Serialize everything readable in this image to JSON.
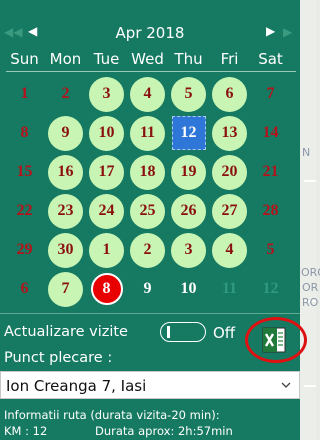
{
  "calendar": {
    "month_title": "Apr 2018",
    "prev_label": "◀",
    "next_label": "▶",
    "weekdays": [
      "Sun",
      "Mon",
      "Tue",
      "Wed",
      "Thu",
      "Fri",
      "Sat"
    ],
    "weeks": [
      [
        {
          "d": "1",
          "s": "plain-red"
        },
        {
          "d": "2",
          "s": "plain-red"
        },
        {
          "d": "3",
          "s": "avail"
        },
        {
          "d": "4",
          "s": "avail"
        },
        {
          "d": "5",
          "s": "avail"
        },
        {
          "d": "6",
          "s": "avail"
        },
        {
          "d": "7",
          "s": "plain-red"
        }
      ],
      [
        {
          "d": "8",
          "s": "plain-red"
        },
        {
          "d": "9",
          "s": "avail"
        },
        {
          "d": "10",
          "s": "avail"
        },
        {
          "d": "11",
          "s": "avail"
        },
        {
          "d": "12",
          "s": "selected"
        },
        {
          "d": "13",
          "s": "avail"
        },
        {
          "d": "14",
          "s": "plain-red"
        }
      ],
      [
        {
          "d": "15",
          "s": "plain-red"
        },
        {
          "d": "16",
          "s": "avail"
        },
        {
          "d": "17",
          "s": "avail"
        },
        {
          "d": "18",
          "s": "avail"
        },
        {
          "d": "19",
          "s": "avail"
        },
        {
          "d": "20",
          "s": "avail"
        },
        {
          "d": "21",
          "s": "plain-red"
        }
      ],
      [
        {
          "d": "22",
          "s": "plain-red"
        },
        {
          "d": "23",
          "s": "avail"
        },
        {
          "d": "24",
          "s": "avail"
        },
        {
          "d": "25",
          "s": "avail"
        },
        {
          "d": "26",
          "s": "avail"
        },
        {
          "d": "27",
          "s": "avail"
        },
        {
          "d": "28",
          "s": "plain-red"
        }
      ],
      [
        {
          "d": "29",
          "s": "plain-red"
        },
        {
          "d": "30",
          "s": "avail"
        },
        {
          "d": "1",
          "s": "avail"
        },
        {
          "d": "2",
          "s": "avail"
        },
        {
          "d": "3",
          "s": "avail"
        },
        {
          "d": "4",
          "s": "avail"
        },
        {
          "d": "5",
          "s": "plain-red"
        }
      ],
      [
        {
          "d": "6",
          "s": "plain-red"
        },
        {
          "d": "7",
          "s": "avail"
        },
        {
          "d": "8",
          "s": "today"
        },
        {
          "d": "9",
          "s": "plain-white"
        },
        {
          "d": "10",
          "s": "plain-white"
        },
        {
          "d": "11",
          "s": "faded"
        },
        {
          "d": "12",
          "s": "faded"
        }
      ]
    ]
  },
  "visits": {
    "label": "Actualizare vizite",
    "toggle_state": "Off",
    "excel_icon": "excel-icon"
  },
  "start": {
    "label": "Punct plecare :",
    "value": "Ion Creanga 7, Iasi"
  },
  "route": {
    "line1": "Informatii ruta (durata vizita-20 min):",
    "km": "KM : 12",
    "duration": "Durata aprox: 2h:57min"
  },
  "map_labels": [
    "N",
    "ORO",
    "OR",
    "RO"
  ],
  "colors": {
    "panel": "#167a62",
    "available_day": "#c8f5b4",
    "weekend_text": "#b5121b",
    "today": "#e80000",
    "selected": "#2e77d8"
  }
}
